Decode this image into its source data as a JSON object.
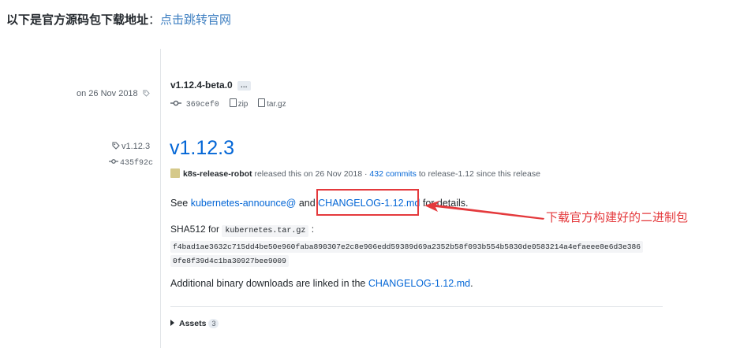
{
  "intro": {
    "label": "以下是官方源码包下载地址",
    "colon": "：",
    "link": "点击跳转官网"
  },
  "beta": {
    "date": "on 26 Nov 2018",
    "title": "v1.12.4-beta.0",
    "ellipsis": "…",
    "commit": "369cef0",
    "zip": "zip",
    "targz": "tar.gz"
  },
  "release": {
    "tag": "v1.12.3",
    "commit": "435f92c",
    "title": "v1.12.3",
    "author": "k8s-release-robot",
    "released_text": "released this on 26 Nov 2018 · ",
    "commits_link": "432 commits",
    "to_branch": " to release-1.12 since this release",
    "see": "See ",
    "announce_link": "kubernetes-announce@",
    "and": " and ",
    "changelog_link": "CHANGELOG-1.12.md",
    "for_details": " for details.",
    "sha_label": "SHA512 for ",
    "sha_file": "kubernetes.tar.gz",
    "sha_colon": " :",
    "hash_line1": "f4bad1ae3632c715dd4be50e960faba890307e2c8e906edd59389d69a2352b58f093b554b5830de0583214a4efaeee8e6d3e386",
    "hash_line2": "0fe8f39d4c1ba30927bee9009",
    "additional": "Additional binary downloads are linked in the ",
    "additional_link": "CHANGELOG-1.12.md",
    "additional_end": ".",
    "assets_label": "Assets",
    "assets_count": "3"
  },
  "annotation": {
    "text": "下载官方构建好的二进制包",
    "color": "#e4393c"
  },
  "colors": {
    "link": "#0366d6",
    "intro_link": "#3e7fc1",
    "text": "#24292e",
    "muted": "#586069"
  }
}
